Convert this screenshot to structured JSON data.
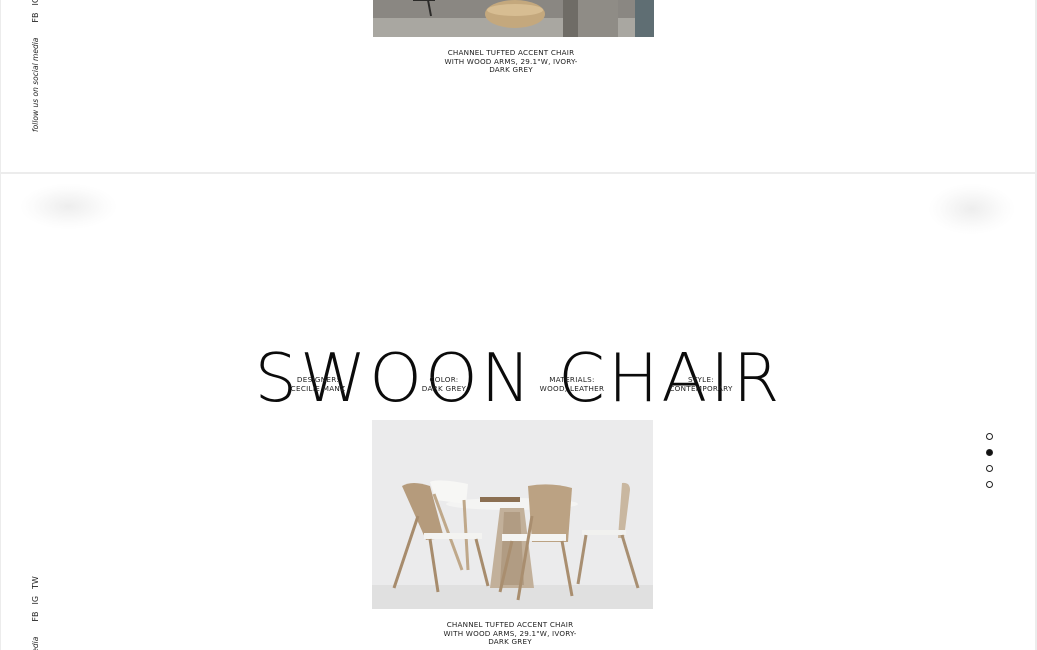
{
  "social": {
    "follow_text": "follow us on social media",
    "follow_text_cropped_bottom": "media",
    "networks": [
      "FB",
      "IG",
      "TW"
    ]
  },
  "top_product": {
    "caption": "CHANNEL TUFTED ACCENT CHAIR WITH WOOD ARMS, 29.1\"W, IVORY-DARK GREY"
  },
  "main_product": {
    "title": "SWOON CHAIR",
    "specs": [
      {
        "label": "DESIGNER:",
        "value": "CECILIE MANZ"
      },
      {
        "label": "COLOR:",
        "value": "DARK GREY"
      },
      {
        "label": "MATERIALS:",
        "value": "WOOD, LEATHER"
      },
      {
        "label": "STYLE:",
        "value": "CONTEMPORARY"
      }
    ],
    "caption": "CHANNEL TUFTED ACCENT CHAIR WITH WOOD ARMS, 29.1\"W, IVORY-DARK GREY"
  },
  "pagination": {
    "count": 4,
    "active_index": 1
  },
  "colors": {
    "background": "#ffffff",
    "text": "#111111",
    "divider": "#ececec"
  }
}
